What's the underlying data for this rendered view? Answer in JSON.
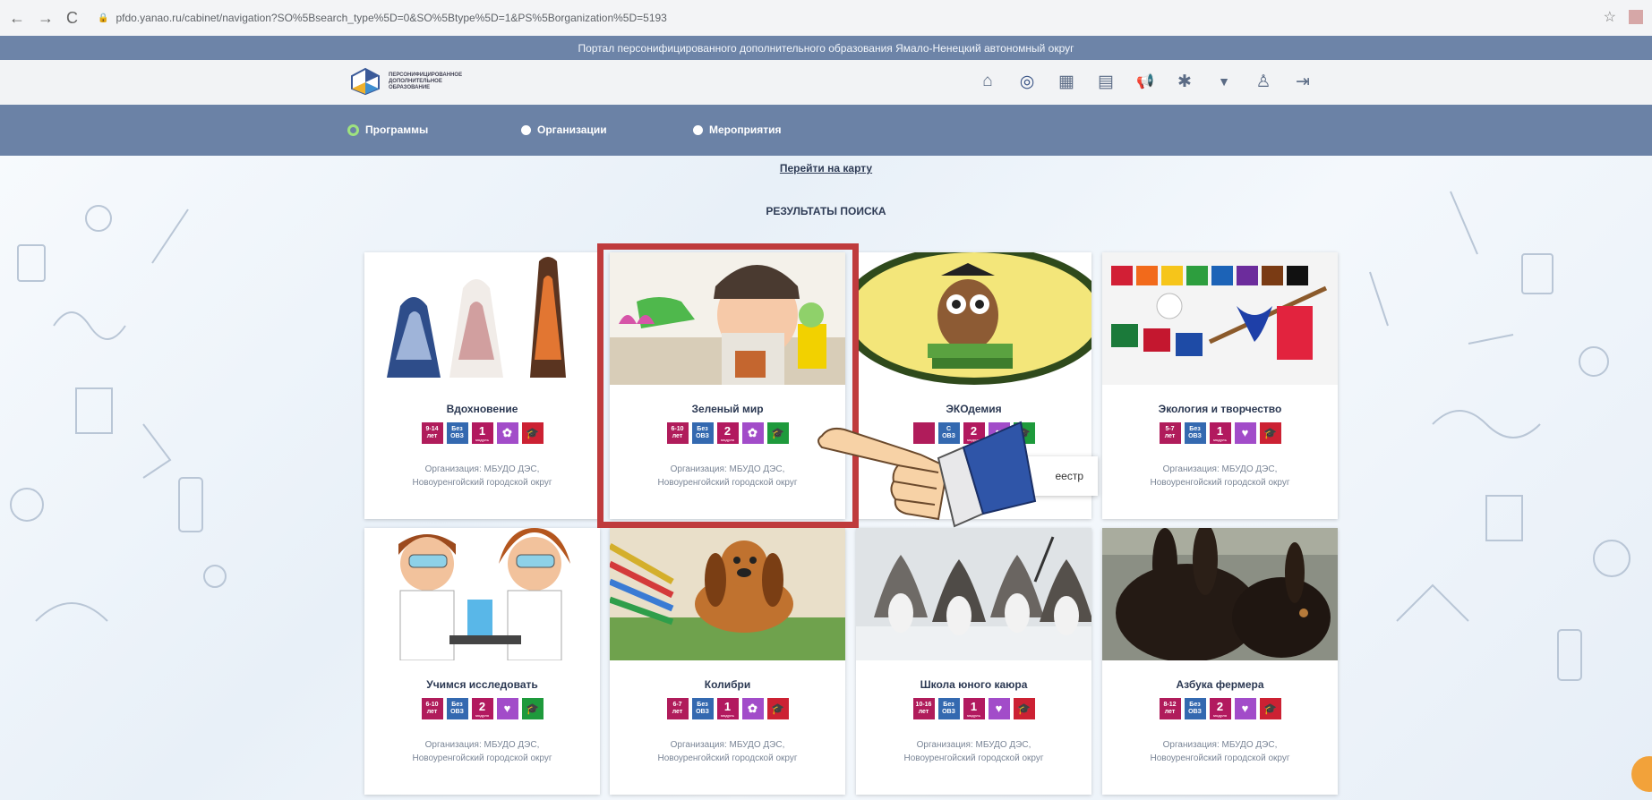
{
  "browser": {
    "url": "pfdo.yanao.ru/cabinet/navigation?SO%5Bsearch_type%5D=0&SO%5Btype%5D=1&PS%5Borganization%5D=5193",
    "back_glyph": "←",
    "forward_glyph": "→",
    "reload_glyph": "C",
    "lock_glyph": "🔒",
    "star_glyph": "☆"
  },
  "portal": {
    "banner": "Портал персонифицированного дополнительного образования Ямало-Ненецкий автономный округ",
    "logo_lines": [
      "ПЕРСОНИФИЦИРОВАННОЕ",
      "ДОПОЛНИТЕЛЬНОЕ",
      "ОБРАЗОВАНИЕ"
    ]
  },
  "header_icons": [
    {
      "name": "home-icon",
      "glyph": "⌂"
    },
    {
      "name": "target-icon",
      "glyph": "◎"
    },
    {
      "name": "calendar-icon",
      "glyph": "▦"
    },
    {
      "name": "document-icon",
      "glyph": "▤"
    },
    {
      "name": "megaphone-icon",
      "glyph": "📢"
    },
    {
      "name": "asterisk-icon",
      "glyph": "✱"
    },
    {
      "name": "filter-icon",
      "glyph": "▼"
    },
    {
      "name": "people-icon",
      "glyph": "♙"
    },
    {
      "name": "logout-icon",
      "glyph": "⇥"
    }
  ],
  "filters": {
    "programs": "Программы",
    "organizations": "Организации",
    "events": "Мероприятия"
  },
  "map_link": "Перейти на карту",
  "results_title": "РЕЗУЛЬТАТЫ ПОИСКА",
  "badge_labels": {
    "years": "лет",
    "no_ovz_top": "Без",
    "no_ovz_bottom": "ОВЗ",
    "with_ovz_top": "С",
    "modules": "модуля",
    "module_one": "модуль"
  },
  "cards": [
    {
      "title": "Вдохновение",
      "age": "9-14",
      "ovz": "Без",
      "modules": "1",
      "org_line1": "Организация: МБУДО ДЭС,",
      "org_line2": "Новоуренгойский городской округ"
    },
    {
      "title": "Зеленый мир",
      "age": "6-10",
      "ovz": "Без",
      "modules": "2",
      "org_line1": "Организация: МБУДО ДЭС,",
      "org_line2": "Новоуренгойский городской округ"
    },
    {
      "title": "ЭКОдемия",
      "age": "",
      "ovz": "С",
      "modules": "2",
      "org_line1": "",
      "org_line2": ""
    },
    {
      "title": "Экология и творчество",
      "age": "5-7",
      "ovz": "Без",
      "modules": "1",
      "org_line1": "Организация: МБУДО ДЭС,",
      "org_line2": "Новоуренгойский городской округ"
    },
    {
      "title": "Учимся исследовать",
      "age": "6-10",
      "ovz": "Без",
      "modules": "2",
      "org_line1": "Организация: МБУДО ДЭС,",
      "org_line2": "Новоуренгойский городской округ"
    },
    {
      "title": "Колибри",
      "age": "6-7",
      "ovz": "Без",
      "modules": "1",
      "org_line1": "Организация: МБУДО ДЭС,",
      "org_line2": "Новоуренгойский городской округ"
    },
    {
      "title": "Школа юного каюра",
      "age": "10-16",
      "ovz": "Без",
      "modules": "1",
      "org_line1": "Организация: МБУДО ДЭС,",
      "org_line2": "Новоуренгойский городской округ"
    },
    {
      "title": "Азбука фермера",
      "age": "8-12",
      "ovz": "Без",
      "modules": "2",
      "org_line1": "Организация: МБУДО ДЭС,",
      "org_line2": "Новоуренгойский городской округ"
    }
  ],
  "tooltip_text": "еестр",
  "colors": {
    "banner": "#6d84a8",
    "filter_bar": "#6b82a6",
    "highlight": "#bf3b3d",
    "badge_age": "#b01c5b",
    "badge_ovz": "#3469b0",
    "badge_purple": "#a24cc9",
    "badge_green": "#1e9a3c",
    "badge_red": "#cc2133"
  }
}
